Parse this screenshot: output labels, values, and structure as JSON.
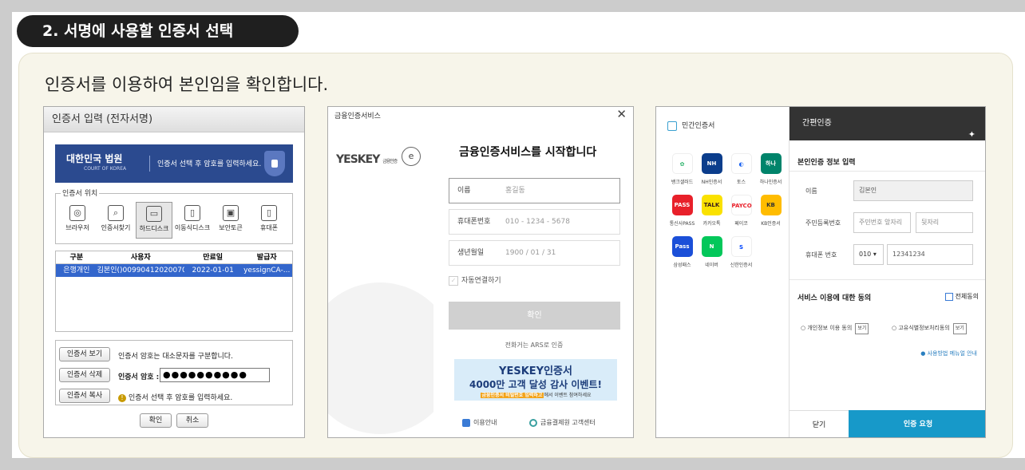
{
  "step": {
    "title": "2. 서명에 사용할 인증서 선택"
  },
  "description": "인증서를 이용하여 본인임을 확인합니다.",
  "shot1": {
    "window_title": "인증서 입력 (전자서명)",
    "banner": {
      "logo": "대한민국 법원",
      "sub": "COURT OF KOREA",
      "message": "인증서 선택 후 암호를 입력하세요."
    },
    "location_legend": "인증서 위치",
    "locations": [
      {
        "label": "브라우저",
        "icon": "globe-icon"
      },
      {
        "label": "인증서찾기",
        "icon": "search-certificate-icon"
      },
      {
        "label": "하드디스크",
        "icon": "monitor-icon"
      },
      {
        "label": "이동식디스크",
        "icon": "usb-icon"
      },
      {
        "label": "보안토큰",
        "icon": "token-icon"
      },
      {
        "label": "휴대폰",
        "icon": "phone-icon"
      }
    ],
    "table": {
      "headers": [
        "구분",
        "사용자",
        "만료일",
        "발급자"
      ],
      "rows": [
        [
          "은행개인",
          "김본인()0099041202007080...",
          "2022-01-01",
          "yessignCA-..."
        ]
      ]
    },
    "buttons": {
      "view": "인증서 보기",
      "delete": "인증서 삭제",
      "copy": "인증서 복사",
      "ok": "확인",
      "cancel": "취소"
    },
    "case_note": "인증서 암호는 대소문자를 구분합니다.",
    "password_label": "인증서 암호 :",
    "password_value": "●●●●●●●●●●",
    "hint": "인증서 선택 후 암호를 입력하세요."
  },
  "shot2": {
    "topbar": "금융인증서비스",
    "logo": "YESKEY",
    "logo_sub": "금융인증",
    "title": "금융인증서비스를 시작합니다",
    "fields": [
      {
        "label": "이름",
        "placeholder": "홍길동"
      },
      {
        "label": "휴대폰번호",
        "placeholder": "010 - 1234 - 5678"
      },
      {
        "label": "생년월일",
        "placeholder": "1900 / 01 / 31"
      }
    ],
    "auto_connect": "자동연결하기",
    "confirm": "확인",
    "ars": "전화거는 ARS로 인증",
    "event": {
      "line1": "YESKEY인증서",
      "line2": "4000만 고객 달성 감사 이벤트!",
      "line3_highlight": "금융인증서 비밀번호 입력하고",
      "line3_rest": "에서 이벤트 참여하세요"
    },
    "footer": {
      "guide": "이용안내",
      "center": "금융결제원 고객센터"
    }
  },
  "shot3": {
    "left_title": "민간인증서",
    "apps": [
      {
        "name": "뱅크샐러드",
        "color": "#ffffff",
        "fg": "#2cb36b",
        "mark": "✿"
      },
      {
        "name": "NH인증서",
        "color": "#0b3d8c",
        "fg": "#ffffff",
        "mark": "NH"
      },
      {
        "name": "토스",
        "color": "#ffffff",
        "fg": "#1b64f2",
        "mark": "◐"
      },
      {
        "name": "하나인증서",
        "color": "#00846b",
        "fg": "#ffffff",
        "mark": "하나"
      },
      {
        "name": "통신사PASS",
        "color": "#e8202a",
        "fg": "#ffffff",
        "mark": "PASS"
      },
      {
        "name": "카카오톡",
        "color": "#fae100",
        "fg": "#3a1d1d",
        "mark": "TALK"
      },
      {
        "name": "페이코",
        "color": "#ffffff",
        "fg": "#e8202a",
        "mark": "PAYCO"
      },
      {
        "name": "KB인증서",
        "color": "#ffbc00",
        "fg": "#333333",
        "mark": "KB"
      },
      {
        "name": "삼성패스",
        "color": "#1b4fd8",
        "fg": "#ffffff",
        "mark": "Pass"
      },
      {
        "name": "네이버",
        "color": "#03c75a",
        "fg": "#ffffff",
        "mark": "N"
      },
      {
        "name": "신한인증서",
        "color": "#ffffff",
        "fg": "#0046ff",
        "mark": "S"
      }
    ],
    "right_title": "간편인증",
    "info_title": "본인인증 정보 입력",
    "name_label": "이름",
    "name_value": "김본인",
    "rrn_label": "주민등록번호",
    "rrn_front": "주민번호 앞자리",
    "rrn_back": "뒷자리",
    "phone_label": "휴대폰 번호",
    "phone_prefix": "010",
    "phone_value": "12341234",
    "consent_title": "서비스 이용에 대한 동의",
    "agree_all": "전체동의",
    "consent1": "개인정보 이용 동의",
    "consent2": "고유식별정보처리동의",
    "view": "보기",
    "guide": "사용방법 메뉴얼 안내",
    "close": "닫기",
    "request": "인증 요청"
  }
}
